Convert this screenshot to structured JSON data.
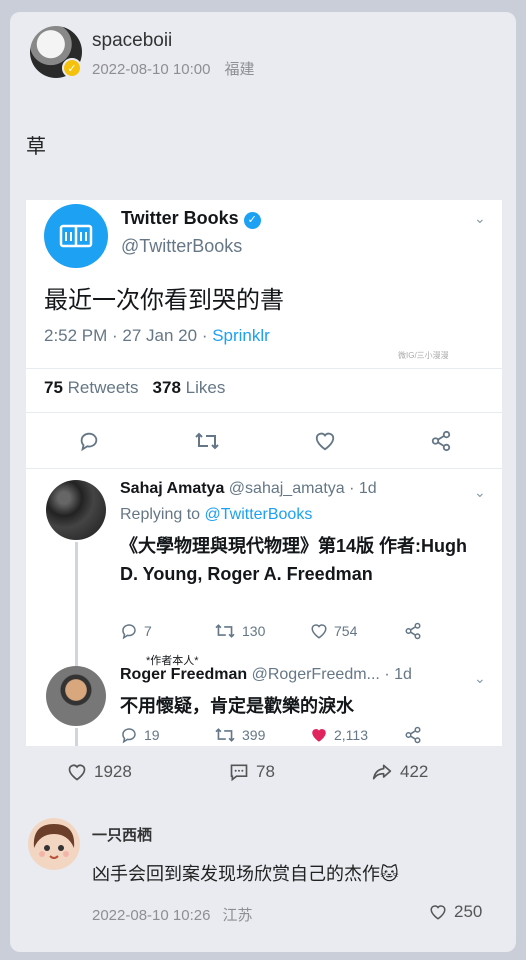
{
  "post": {
    "username": "spaceboii",
    "timestamp": "2022-08-10 10:00",
    "location": "福建",
    "text": "草",
    "likes": "1928",
    "comments": "78",
    "reposts": "422"
  },
  "tweet": {
    "account_name": "Twitter Books",
    "handle": "@TwitterBooks",
    "text": "最近一次你看到哭的書",
    "meta": "2:52 PM · 27 Jan 20 · ",
    "source": "Sprinklr",
    "watermark": "微IG/三小漫漫",
    "retweets_count": "75",
    "retweets_label": "Retweets",
    "likes_count": "378",
    "likes_label": "Likes"
  },
  "replies": [
    {
      "name": "Sahaj Amatya",
      "handle_time": "@sahaj_amatya · 1d",
      "replying_prefix": "Replying to ",
      "replying_to": "@TwitterBooks",
      "body": "《大學物理與現代物理》第14版 作者:Hugh D. Young, Roger A. Freedman",
      "reply_count": "7",
      "retweet_count": "130",
      "like_count": "754"
    },
    {
      "note": "*作者本人*",
      "name": "Roger Freedman",
      "handle_time": "@RogerFreedm... · 1d",
      "body": "不用懷疑，肯定是歡樂的淚水",
      "reply_count": "19",
      "retweet_count": "399",
      "like_count": "2,113"
    }
  ],
  "comment": {
    "username": "一只西栖",
    "text": "凶手会回到案发现场欣赏自己的杰作",
    "emoji": "🐱",
    "timestamp": "2022-08-10 10:26",
    "location": "江苏",
    "likes": "250"
  },
  "colors": {
    "twitter_blue": "#1da1f2",
    "liked_red": "#e0245e",
    "badge_yellow": "#f4c20d"
  }
}
